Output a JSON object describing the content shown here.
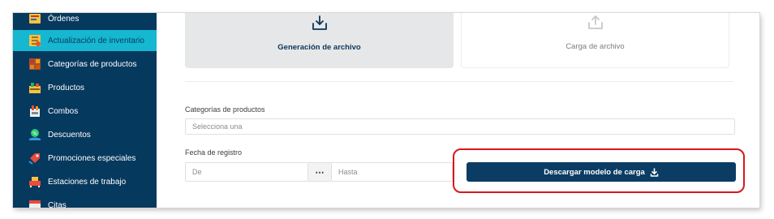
{
  "sidebar": {
    "items": [
      {
        "label": "Órdenes",
        "icon": "orders-icon"
      },
      {
        "label": "Actualización de inventario",
        "icon": "inventory-update-icon",
        "active": true
      },
      {
        "label": "Categorías de productos",
        "icon": "product-categories-icon"
      },
      {
        "label": "Productos",
        "icon": "products-icon"
      },
      {
        "label": "Combos",
        "icon": "combos-icon"
      },
      {
        "label": "Descuentos",
        "icon": "discounts-icon"
      },
      {
        "label": "Promociones especiales",
        "icon": "special-promotions-icon"
      },
      {
        "label": "Estaciones de trabajo",
        "icon": "workstations-icon"
      },
      {
        "label": "Citas",
        "icon": "appointments-icon"
      }
    ]
  },
  "cards": {
    "generate_label": "Generación de archivo",
    "upload_label": "Carga de archivo"
  },
  "form": {
    "category_label": "Categorías de productos",
    "category_placeholder": "Selecciona una",
    "date_label": "Fecha de registro",
    "from_placeholder": "De",
    "separator": "⋯",
    "to_placeholder": "Hasta",
    "download_label": "Descargar modelo de carga"
  },
  "colors": {
    "sidebar_bg": "#06395e",
    "active_item": "#15b7d1",
    "primary_button": "#0b3d64",
    "highlight": "#d9171b"
  }
}
